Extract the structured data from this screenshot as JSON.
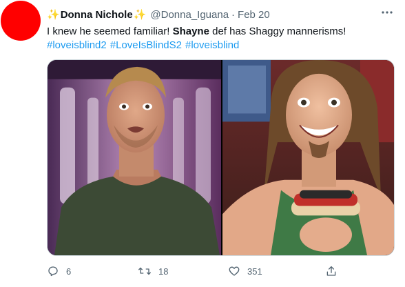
{
  "author": {
    "sparkle_left": "✨",
    "display_name": "Donna Nichole",
    "sparkle_right": "✨",
    "handle": "@Donna_Iguana",
    "separator": "·",
    "timestamp": "Feb 20",
    "avatar_color": "#ff0000"
  },
  "tweet": {
    "text_before": "I knew he seemed familiar! ",
    "text_bold": "Shayne",
    "text_after": " def has Shaggy mannerisms!",
    "hashtags": [
      "#loveisblind2",
      "#LoveIsBlindS2",
      "#loveisblind"
    ]
  },
  "actions": {
    "reply_count": "6",
    "retweet_count": "18",
    "like_count": "351"
  },
  "colors": {
    "link": "#1d9bf0",
    "secondary_text": "#536471",
    "sparkle": "#f5b800"
  },
  "icons": {
    "more": "more-icon",
    "reply": "reply-icon",
    "retweet": "retweet-icon",
    "like": "heart-icon",
    "share": "share-icon"
  }
}
